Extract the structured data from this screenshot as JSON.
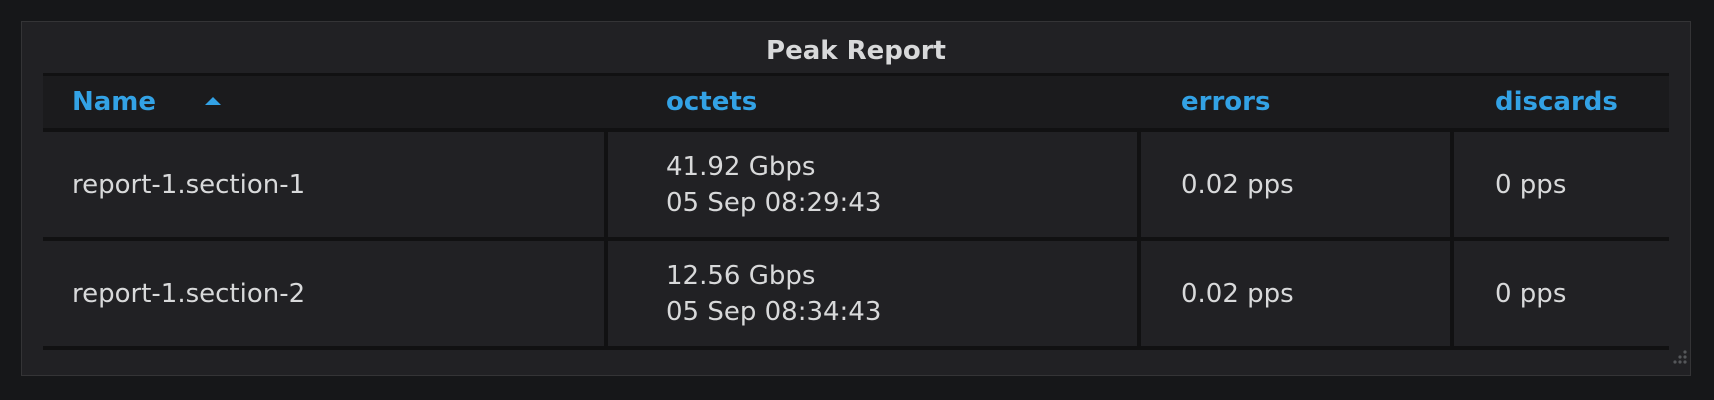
{
  "panel": {
    "title": "Peak Report"
  },
  "table": {
    "columns": [
      {
        "label": "Name",
        "sorted": "ascending"
      },
      {
        "label": "octets"
      },
      {
        "label": "errors"
      },
      {
        "label": "discards"
      }
    ],
    "rows": [
      {
        "name": "report-1.section-1",
        "octets_value": "41.92 Gbps",
        "octets_time": "05 Sep 08:29:43",
        "errors": "0.02 pps",
        "discards": "0 pps"
      },
      {
        "name": "report-1.section-2",
        "octets_value": "12.56 Gbps",
        "octets_time": "05 Sep 08:34:43",
        "errors": "0.02 pps",
        "discards": "0 pps"
      }
    ]
  },
  "colors": {
    "accent": "#33a2e5",
    "background": "#161719",
    "panel": "#212124",
    "text": "#d8d9da"
  },
  "icons": {
    "sort": "caret-up-icon",
    "resize": "resize-handle-icon"
  }
}
